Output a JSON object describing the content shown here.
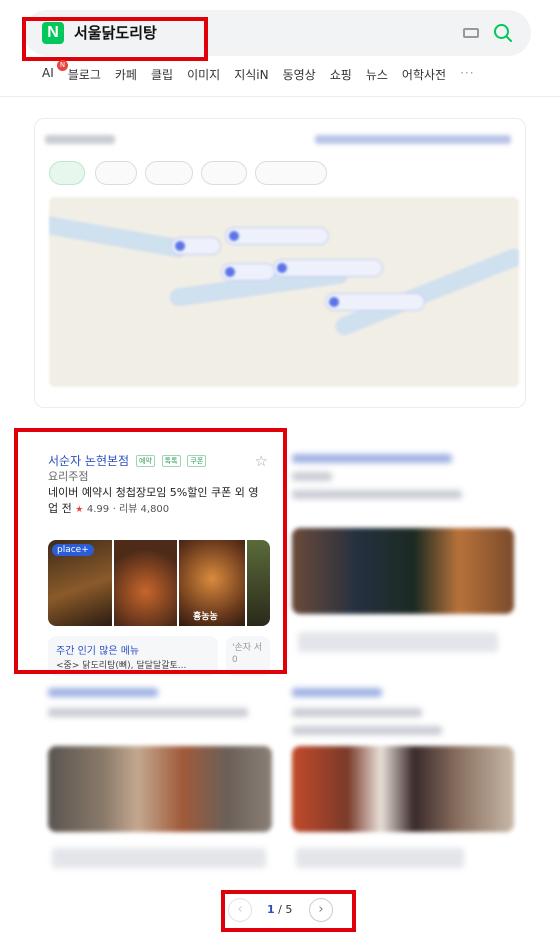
{
  "search": {
    "logo_letter": "N",
    "query": "서울닭도리탕"
  },
  "tabs": [
    "AI",
    "블로그",
    "카페",
    "클립",
    "이미지",
    "지식iN",
    "동영상",
    "쇼핑",
    "뉴스",
    "어학사전"
  ],
  "ai_badge": "N",
  "more": "···",
  "featured_restaurant": {
    "name": "서순자 논현본점",
    "badges": [
      "예약",
      "톡톡",
      "쿠폰"
    ],
    "category": "요리주점",
    "description": "네이버 예약시 청첩장모임 5%할인 쿠폰 외 영업 전",
    "rating_star": "★",
    "rating": "4.99",
    "review_label": "리뷰 4,800",
    "photo_tag": "place+",
    "photo_caption": "흉농농",
    "menu_title": "주간 인기 많은 메뉴",
    "menu_items": "<중> 닭도리탕(뼈), 달달달갈토...",
    "menu2_text": "'손자 서 0"
  },
  "pagination": {
    "current": "1",
    "total": "5",
    "separator": "/"
  },
  "colors": {
    "naver_green": "#03c75a",
    "link_blue": "#2a4fc0",
    "highlight_red": "#e0000a"
  }
}
